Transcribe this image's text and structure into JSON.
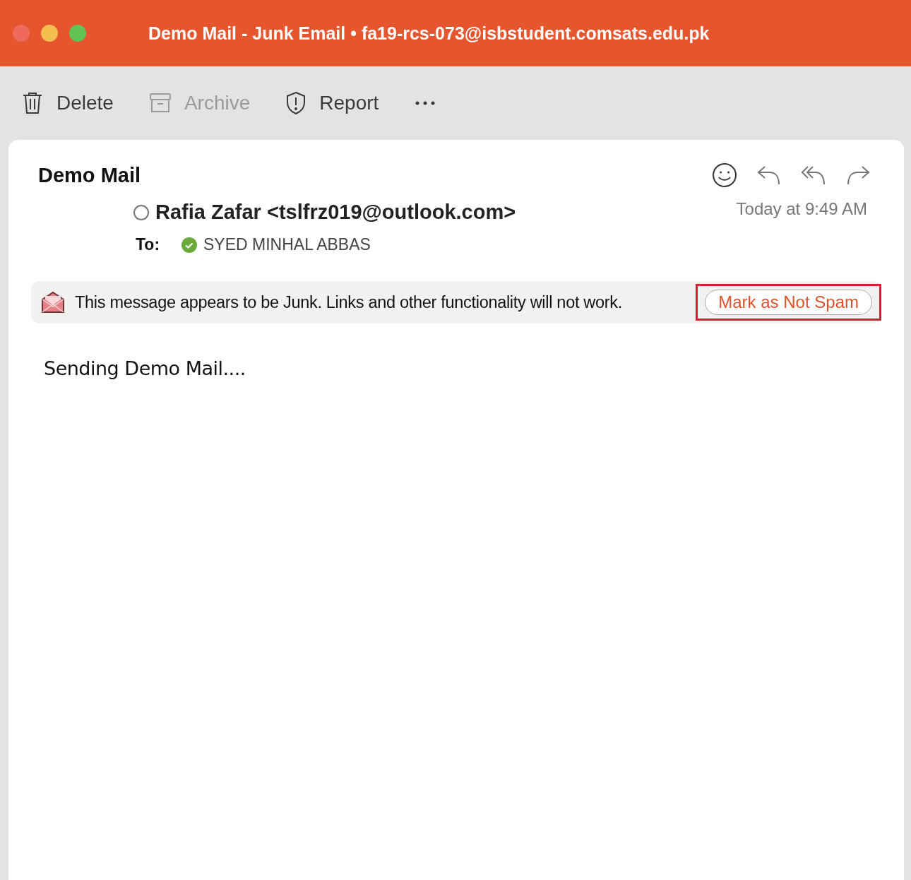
{
  "window": {
    "title": "Demo Mail - Junk Email • fa19-rcs-073@isbstudent.comsats.edu.pk"
  },
  "toolbar": [
    {
      "kind": "delete",
      "label": "Delete",
      "disabled": false
    },
    {
      "kind": "archive",
      "label": "Archive",
      "disabled": true
    },
    {
      "kind": "report",
      "label": "Report",
      "disabled": false
    },
    {
      "kind": "more",
      "disabled": false
    }
  ],
  "message": {
    "subject": "Demo Mail",
    "sender": "Rafia Zafar <tslfrz019@outlook.com>",
    "time": "Today at 9:49 AM",
    "to_label": "To:",
    "recipient": "SYED MINHAL ABBAS",
    "recipient_verified": true,
    "junk_banner": {
      "text": "This message appears to be Junk. Links and other functionality will not work.",
      "button": "Mark as Not Spam",
      "highlighted": true
    },
    "body": "Sending Demo Mail...."
  }
}
